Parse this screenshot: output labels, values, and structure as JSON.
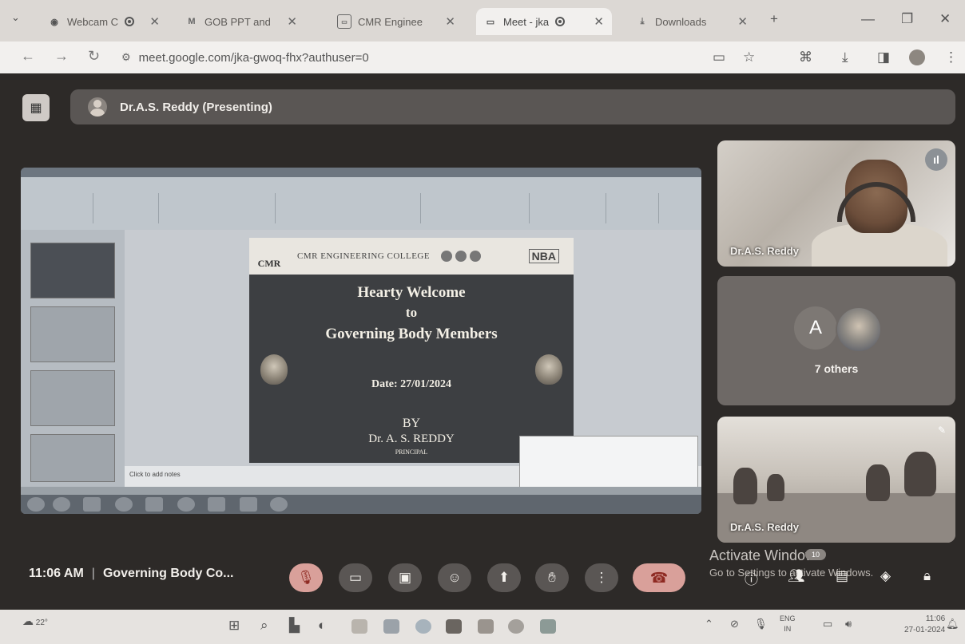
{
  "browser": {
    "tabs": [
      {
        "title": "Webcam C",
        "icon": "webcam-icon",
        "recording": true
      },
      {
        "title": "GOB PPT and",
        "icon": "gmail-icon"
      },
      {
        "title": "CMR Enginee",
        "icon": "classroom-icon"
      },
      {
        "title": "Meet - jka",
        "icon": "meet-icon",
        "recording": true,
        "active": true
      },
      {
        "title": "Downloads",
        "icon": "download-icon"
      }
    ],
    "url": "meet.google.com/jka-gwoq-fhx?authuser=0"
  },
  "meet": {
    "presenter_label": "Dr.A.S. Reddy (Presenting)",
    "time": "11:06 AM",
    "meeting_title": "Governing Body Co...",
    "tiles": [
      {
        "name": "Dr.A.S. Reddy"
      },
      {
        "avatar_letter": "A",
        "others_label": "7 others"
      },
      {
        "name": "Dr.A.S. Reddy"
      }
    ],
    "controls": [
      "mic-off-icon",
      "camera-icon",
      "captions-icon",
      "emoji-icon",
      "present-icon",
      "raise-hand-icon",
      "more-icon",
      "end-call-icon"
    ],
    "right_controls": [
      "info-icon",
      "people-icon",
      "chat-icon",
      "activities-icon",
      "host-controls-icon"
    ],
    "people_badge": "10"
  },
  "shared_slide": {
    "college": "CMR ENGINEERING COLLEGE",
    "logo": "CMR",
    "accreditation": "NBA",
    "line1": "Hearty Welcome",
    "line2": "to",
    "line3": "Governing Body Members",
    "date": "Date: 27/01/2024",
    "by": "BY",
    "presenter": "Dr. A. S. REDDY",
    "role": "PRINCIPAL",
    "notes_placeholder": "Click to add notes"
  },
  "watermark": {
    "line1": "Activate Windows",
    "line2": "Go to Settings to activate Windows."
  },
  "taskbar": {
    "weather": "22°",
    "lang1": "ENG",
    "lang2": "IN",
    "time": "11:06",
    "date": "27-01-2024"
  },
  "colors": {
    "meet_bg": "#2d2a28",
    "end_call": "#d9a09a",
    "slide_bg": "#3d3f42"
  }
}
